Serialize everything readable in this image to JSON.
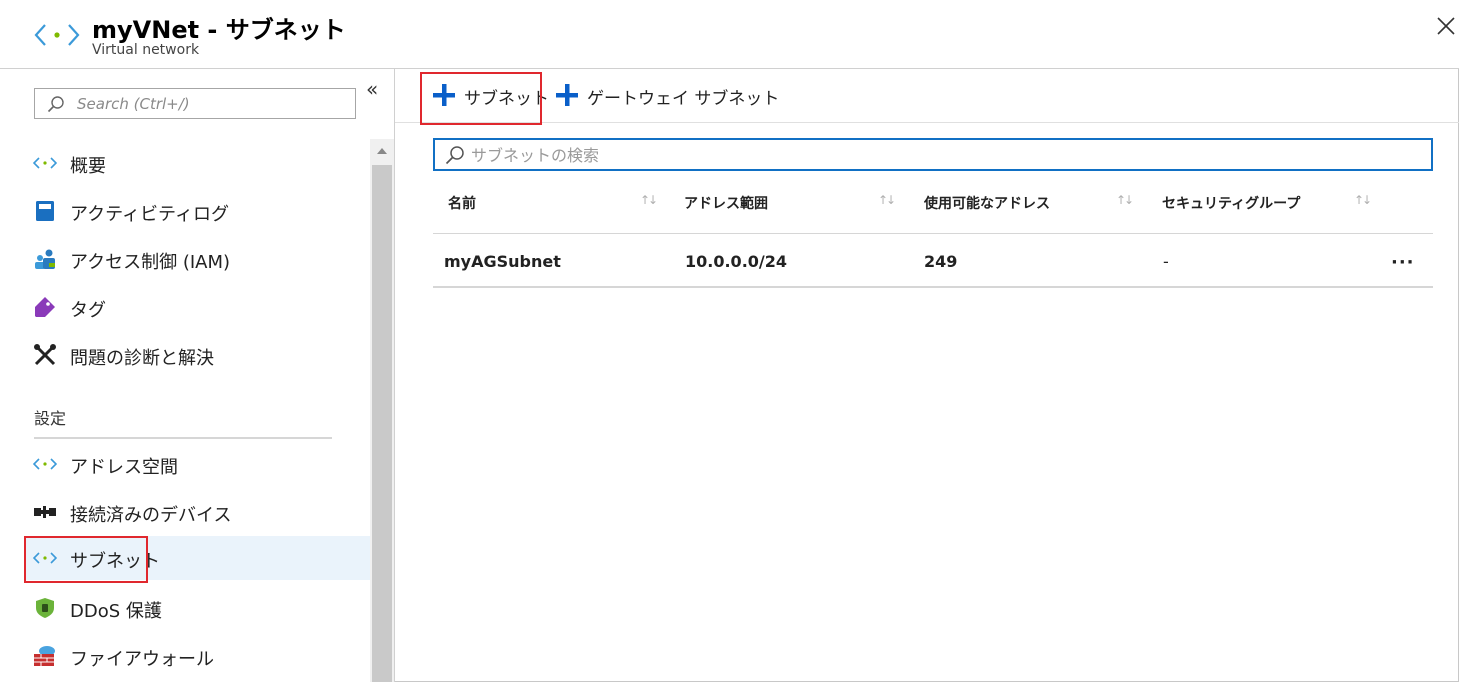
{
  "header": {
    "title": "myVNet - サブネット",
    "subtitle": "Virtual network"
  },
  "sidebar": {
    "search_placeholder": "Search (Ctrl+/)",
    "items": [
      {
        "label": "概要",
        "icon": "vnet-icon"
      },
      {
        "label": "アクティビティログ",
        "icon": "activity-log-icon"
      },
      {
        "label": "アクセス制御 (IAM)",
        "icon": "iam-icon"
      },
      {
        "label": "タグ",
        "icon": "tag-icon"
      },
      {
        "label": "問題の診断と解決",
        "icon": "wrench-icon"
      }
    ],
    "section_settings": "設定",
    "settings_items": [
      {
        "label": "アドレス空間",
        "icon": "vnet-icon"
      },
      {
        "label": "接続済みのデバイス",
        "icon": "connected-devices-icon"
      },
      {
        "label": "サブネット",
        "icon": "vnet-icon",
        "active": true
      },
      {
        "label": "DDoS 保護",
        "icon": "shield-icon"
      },
      {
        "label": "ファイアウォール",
        "icon": "firewall-icon"
      }
    ]
  },
  "toolbar": {
    "add_subnet_label": "サブネット",
    "add_gateway_subnet_label": "ゲートウェイ サブネット"
  },
  "filter": {
    "placeholder": "サブネットの検索"
  },
  "table": {
    "columns": [
      "名前",
      "アドレス範囲",
      "使用可能なアドレス",
      "セキュリティグループ"
    ],
    "rows": [
      {
        "name": "myAGSubnet",
        "address_range": "10.0.0.0/24",
        "available": "249",
        "security_group": "-"
      }
    ]
  },
  "colors": {
    "accent": "#0078d4",
    "highlight": "#e0282e",
    "active_bg": "#eaf3fb"
  }
}
